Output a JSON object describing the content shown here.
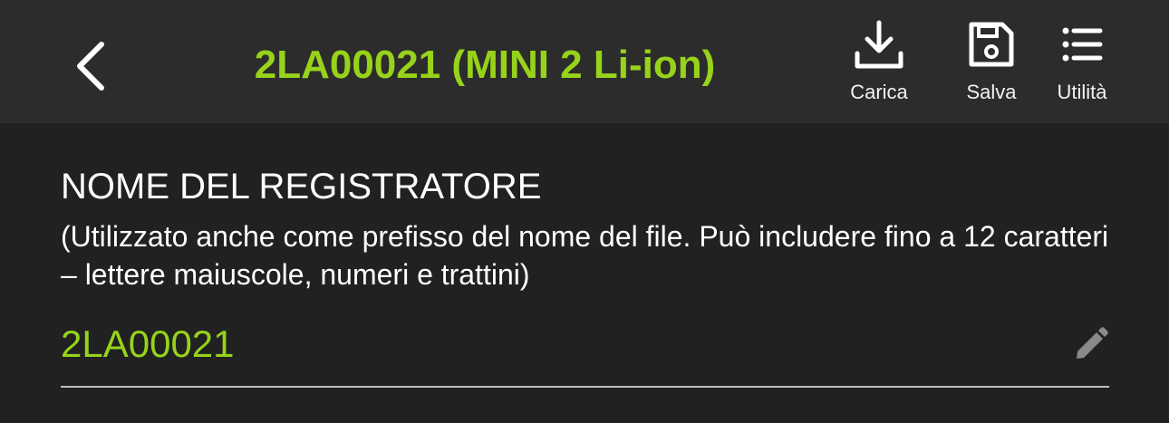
{
  "header": {
    "title": "2LA00021 (MINI 2 Li-ion)",
    "back_icon": "chevron-left-icon",
    "actions": [
      {
        "label": "Carica",
        "icon": "download-icon"
      },
      {
        "label": "Salva",
        "icon": "save-icon"
      },
      {
        "label": "Utilità",
        "icon": "list-icon"
      }
    ]
  },
  "recorder_name": {
    "title": "NOME DEL REGISTRATORE",
    "description": "(Utilizzato anche come prefisso del nome del file. Può includere fino a 12 caratteri – lettere maiuscole, numeri e trattini)",
    "value": "2LA00021",
    "edit_icon": "pencil-icon"
  },
  "colors": {
    "accent": "#97d31a",
    "background": "#212121",
    "header_background": "#2c2c2c",
    "text": "#ffffff",
    "icon_muted": "#8a8a8a"
  }
}
